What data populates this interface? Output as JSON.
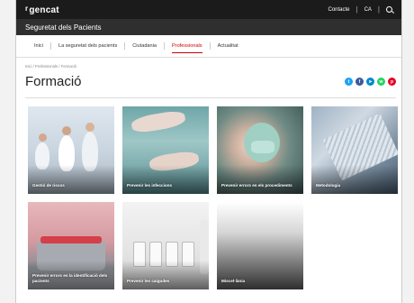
{
  "topbar": {
    "logo": "gencat",
    "links": [
      "Contacte",
      "CA"
    ]
  },
  "site": {
    "title": "Seguretat dels Pacients"
  },
  "nav": {
    "items": [
      "Inici",
      "La seguretat dels pacients",
      "Ciutadania",
      "Professionals",
      "Actualitat"
    ],
    "active_index": 3
  },
  "breadcrumb": "Inici / Professionals / Formació",
  "page": {
    "title": "Formació"
  },
  "share": {
    "icons": [
      "twitter-icon",
      "facebook-icon",
      "telegram-icon",
      "whatsapp-icon",
      "pinterest-icon"
    ],
    "colors": [
      "#1da1f2",
      "#3b5998",
      "#0088cc",
      "#25d366",
      "#e60023"
    ]
  },
  "cards": [
    {
      "label": "Gestió de riscos"
    },
    {
      "label": "Prevenir les infeccions"
    },
    {
      "label": "Prevenir errors en els procediments"
    },
    {
      "label": "Metodologia"
    },
    {
      "label": "Prevenir errors en la identificació dels pacients"
    },
    {
      "label": "Prevenir les caigudes"
    },
    {
      "label": "Miscel·lània"
    }
  ]
}
